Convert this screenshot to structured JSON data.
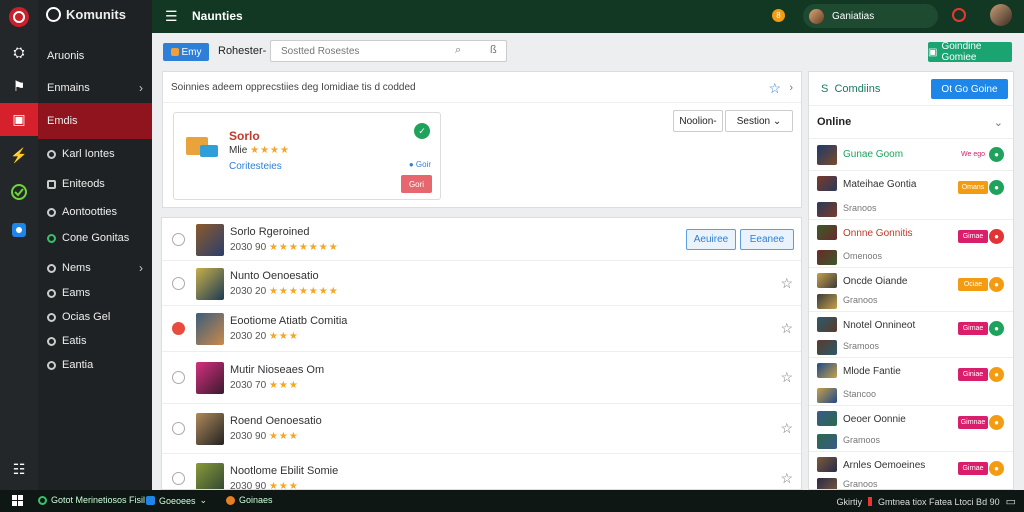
{
  "app": {
    "name": "Komunits"
  },
  "sidebar": {
    "items": [
      {
        "label": "Aruonis",
        "chevron": false,
        "active": false
      },
      {
        "label": "Enmains",
        "chevron": true,
        "active": false
      },
      {
        "label": "Emdis",
        "chevron": false,
        "active": true
      },
      {
        "label": "Karl Iontes",
        "chevron": false,
        "active": false
      },
      {
        "label": "Eniteods",
        "chevron": false,
        "active": false
      },
      {
        "label": "Aontootties",
        "chevron": false,
        "active": false
      },
      {
        "label": "Cone Gonitas",
        "chevron": false,
        "active": false
      },
      {
        "label": "Nems",
        "chevron": true,
        "active": false
      },
      {
        "label": "Eams",
        "chevron": false,
        "active": false
      },
      {
        "label": "Ocias Gel",
        "chevron": false,
        "active": false
      },
      {
        "label": "Eatis",
        "chevron": false,
        "active": false
      },
      {
        "label": "Eantia",
        "chevron": false,
        "active": false
      }
    ]
  },
  "header": {
    "title": "Naunties",
    "user_name": "Ganiatias",
    "notif_count": "8"
  },
  "toolbar": {
    "btn_label": "Emy",
    "filter_label": "Rohester-",
    "search_placeholder": "Sostted Rosestes",
    "green_btn": "Goindine Gomiee"
  },
  "featured": {
    "crumb": "Soinnies adeem opprecstiies deg Iomidiae tis d codded",
    "game": {
      "name": "Sorlo",
      "meta": "Mlie",
      "stars": "★★★★",
      "sub": "Coritesteies",
      "tag": "● Goir",
      "delete": "Gori"
    },
    "sort1": "Noolion-",
    "sort2": "Sestion"
  },
  "list": {
    "buttons": {
      "b1": "Aeuiree",
      "b2": "Eeanee"
    },
    "rows": [
      {
        "name": "Sorlo Rgeroined",
        "meta": "2030  90",
        "stars": "★★★★★★★",
        "selected": false,
        "c1": "#8a5a2b",
        "c2": "#2b3e6b"
      },
      {
        "name": "Nunto Oenoesatio",
        "meta": "2030  20",
        "stars": "★★★★★★★",
        "selected": false,
        "c1": "#c7b04a",
        "c2": "#1d3a54"
      },
      {
        "name": "Eootiome Atiatb Comitia",
        "meta": "2030  20",
        "stars": "★★★",
        "selected": true,
        "c1": "#3c5d7c",
        "c2": "#c98a4a"
      },
      {
        "name": "Mutir Nioseaes Om",
        "meta": "2030  70",
        "stars": "★★★",
        "selected": false,
        "c1": "#d4307f",
        "c2": "#3a1a2e"
      },
      {
        "name": "Roend Oenoesatio",
        "meta": "2030  90",
        "stars": "★★★",
        "selected": false,
        "c1": "#b08a5a",
        "c2": "#222222"
      },
      {
        "name": "Nootlome Ebilit Somie",
        "meta": "2030  90",
        "stars": "★★★",
        "selected": false,
        "c1": "#8a9a3a",
        "c2": "#2a4030"
      }
    ]
  },
  "right": {
    "heading": "Comdiins",
    "button": "Ot Go Goine",
    "online_label": "Online",
    "friends": [
      {
        "name": "Gunae Goom",
        "sub": "",
        "badge": "We ego",
        "badge_color": "#fff",
        "dot_color": "#1fa25b",
        "name_color": "#1fa25b",
        "c1": "#1d3a6b",
        "c2": "#7a4a2a"
      },
      {
        "name": "Mateihae Gontia",
        "sub": "Sranoos",
        "badge": "Omans",
        "badge_color": "#f39c12",
        "dot_color": "#1fa25b",
        "name_color": "#333333",
        "c1": "#7a3a2a",
        "c2": "#2a3a5a"
      },
      {
        "name": "Onnne Gonnitis",
        "sub": "Omenoos",
        "badge": "Gimae",
        "badge_color": "#d91e6b",
        "dot_color": "#e33333",
        "name_color": "#c0392b",
        "c1": "#3a5a2a",
        "c2": "#6a2a2a"
      },
      {
        "name": "Oncde Oiande",
        "sub": "Granoos",
        "badge": "Ociae",
        "badge_color": "#f39c12",
        "dot_color": "#f39c12",
        "name_color": "#333333",
        "c1": "#c7a04a",
        "c2": "#3a3a3a"
      },
      {
        "name": "Nnotel Onnineot",
        "sub": "Sramoos",
        "badge": "Gimae",
        "badge_color": "#d91e6b",
        "dot_color": "#1fa25b",
        "name_color": "#333333",
        "c1": "#2a5a6a",
        "c2": "#5a3a2a"
      },
      {
        "name": "Mlode Fantie",
        "sub": "Stancoo",
        "badge": "Giniae",
        "badge_color": "#d91e6b",
        "dot_color": "#f39c12",
        "name_color": "#333333",
        "c1": "#1d4a8a",
        "c2": "#c7a04a"
      },
      {
        "name": "Oeoer Oonnie",
        "sub": "Gramoos",
        "badge": "Gimnae",
        "badge_color": "#d91e6b",
        "dot_color": "#f39c12",
        "name_color": "#333333",
        "c1": "#3a5a8a",
        "c2": "#2a6a4a"
      },
      {
        "name": "Arnles Oemoeines",
        "sub": "Granoos",
        "badge": "Girnae",
        "badge_color": "#d91e6b",
        "dot_color": "#f39c12",
        "name_color": "#333333",
        "c1": "#7a5a3a",
        "c2": "#2a2a4a"
      }
    ]
  },
  "taskbar": {
    "t1": "Gotot Merinetiosos  Fisil",
    "t2": "Goeoees",
    "t3": "Goinaes",
    "tray_left": "Gkirtiy",
    "tray_right": "Gmtnea tiox Fatea Ltoci Bd 90"
  }
}
